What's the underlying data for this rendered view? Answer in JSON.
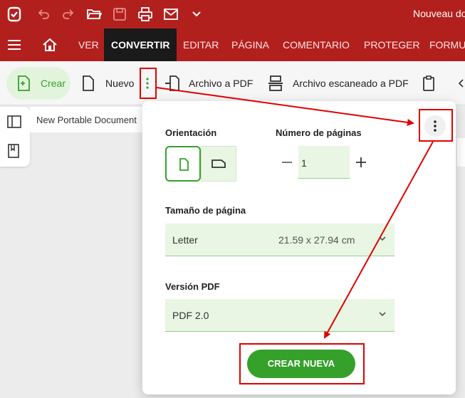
{
  "window": {
    "title": "Nouveau do"
  },
  "titlebar_icons": [
    "app-logo-icon",
    "undo-icon",
    "redo-icon",
    "open-folder-icon",
    "save-icon",
    "print-icon",
    "mail-icon",
    "chevron-down-icon"
  ],
  "menu": {
    "items": [
      "VER",
      "CONVERTIR",
      "EDITAR",
      "PÁGINA",
      "COMENTARIO",
      "PROTEGER",
      "FORMU"
    ],
    "active": "CONVERTIR"
  },
  "ribbon": {
    "crear": "Crear",
    "nuevo": "Nuevo",
    "archivo_a_pdf": "Archivo a PDF",
    "archivo_escaneado": "Archivo escaneado a PDF"
  },
  "document": {
    "tab_title": "New Portable Document"
  },
  "popup": {
    "orientation_label": "Orientación",
    "pages_label": "Número de páginas",
    "pages_value": "1",
    "page_size_label": "Tamaño de página",
    "page_size_value": "Letter",
    "page_size_dims": "21.59 x 27.94 cm",
    "pdf_version_label": "Versión PDF",
    "pdf_version_value": "PDF 2.0",
    "create_button": "CREAR NUEVA"
  },
  "colors": {
    "brand_red": "#b2201d",
    "accent_green": "#35a12b",
    "annotation_red": "#e00000"
  }
}
